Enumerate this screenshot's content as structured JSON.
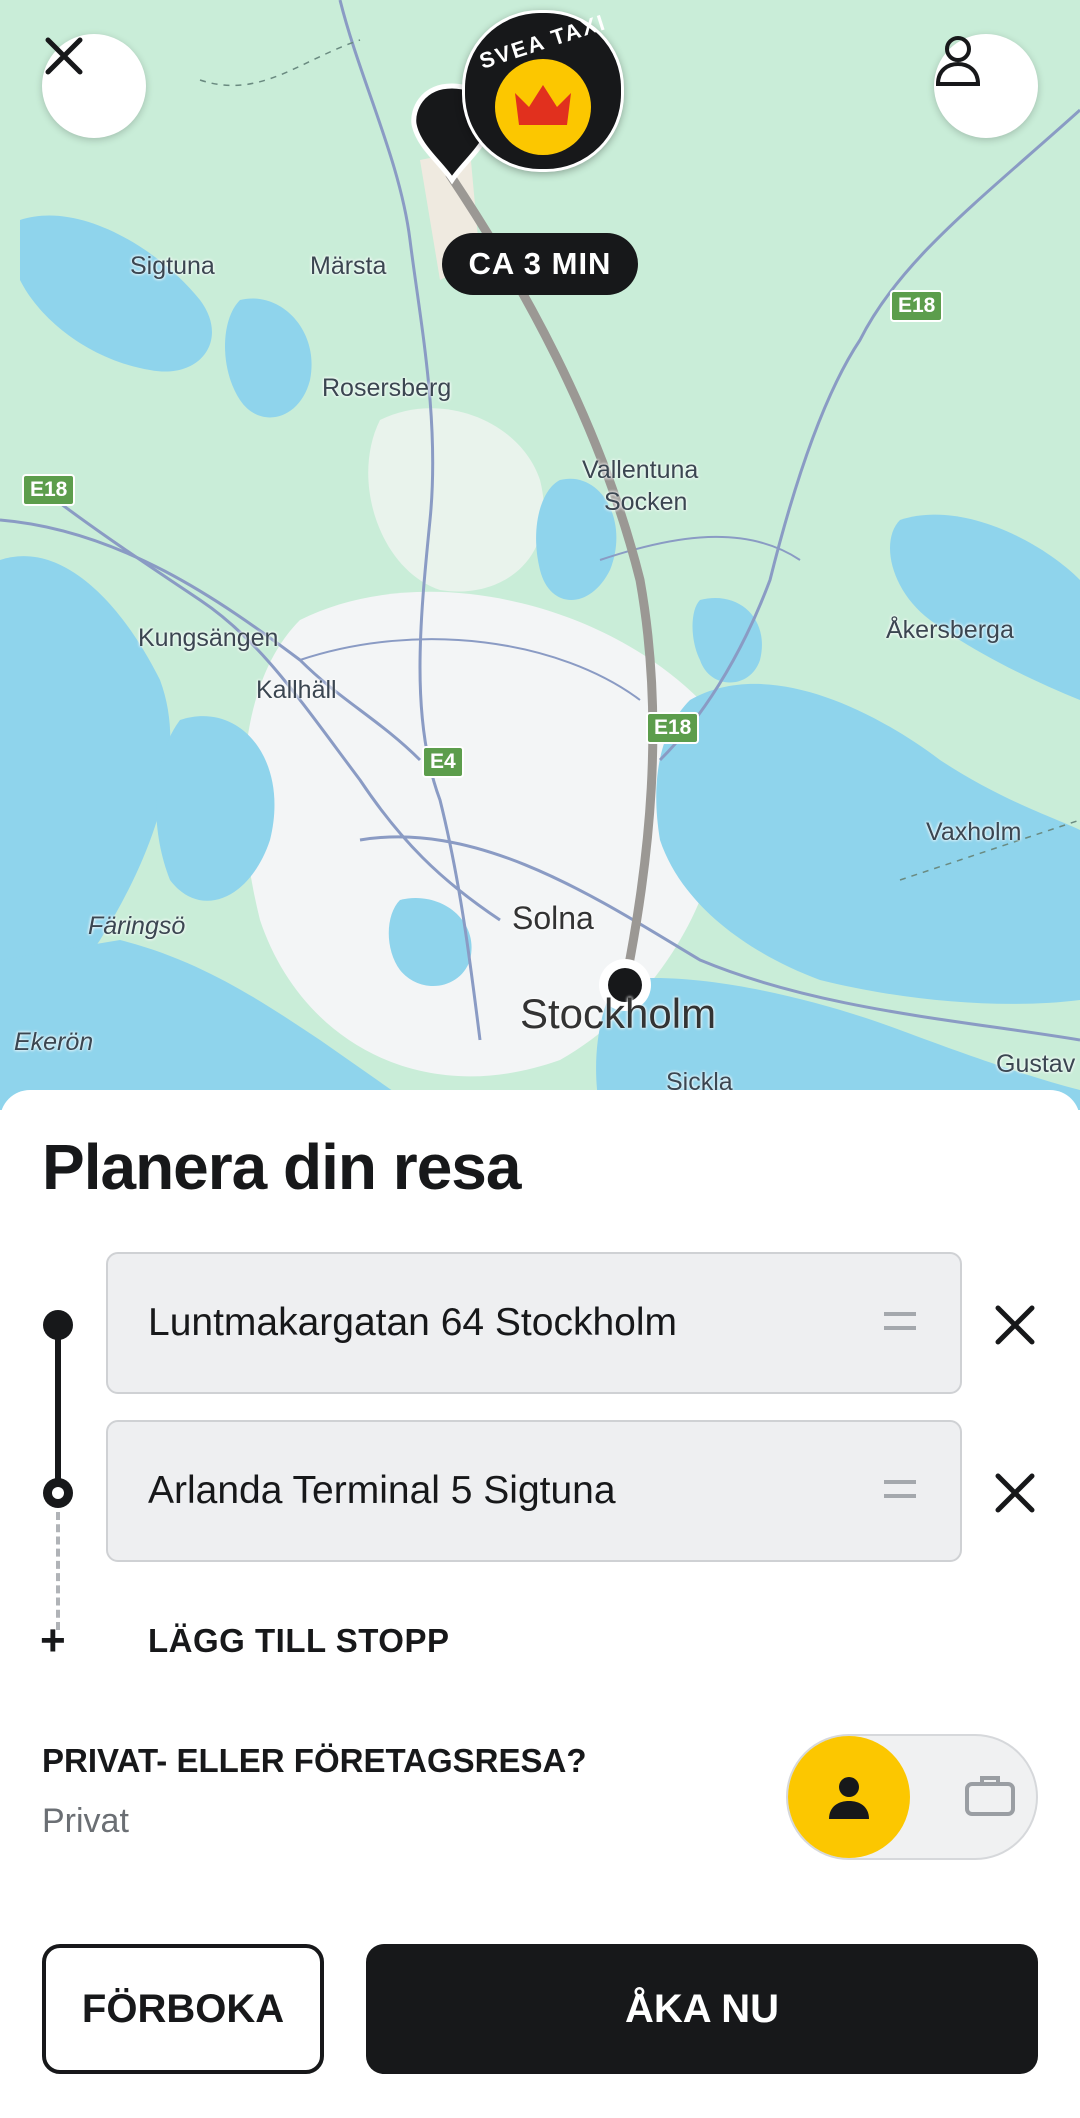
{
  "map": {
    "eta": "CA 3 MIN",
    "logo_text": "SVEA TAXI",
    "places": [
      "Sigtuna",
      "Märsta",
      "Rosersberg",
      "Vallentuna",
      "Socken",
      "Åkersberga",
      "Kungsängen",
      "Kallhäll",
      "Vaxholm",
      "Färingsö",
      "Solna",
      "Stockholm",
      "Ekerön",
      "Sickla",
      "Gustav"
    ],
    "roads": [
      "E18",
      "E18",
      "E18",
      "E4"
    ]
  },
  "sheet": {
    "title": "Planera din resa",
    "from_address": "Luntmakargatan 64 Stockholm",
    "to_address": "Arlanda Terminal 5 Sigtuna",
    "add_stop": "LÄGG TILL STOPP",
    "trip_type_question": "PRIVAT- ELLER FÖRETAGSRESA?",
    "trip_type_value": "Privat",
    "prebook_button": "FÖRBOKA",
    "go_now_button": "ÅKA NU"
  },
  "colors": {
    "accent": "#fcc700",
    "dark": "#17181a",
    "map_land": "#cdeedc",
    "map_water": "#8fd4ec"
  }
}
